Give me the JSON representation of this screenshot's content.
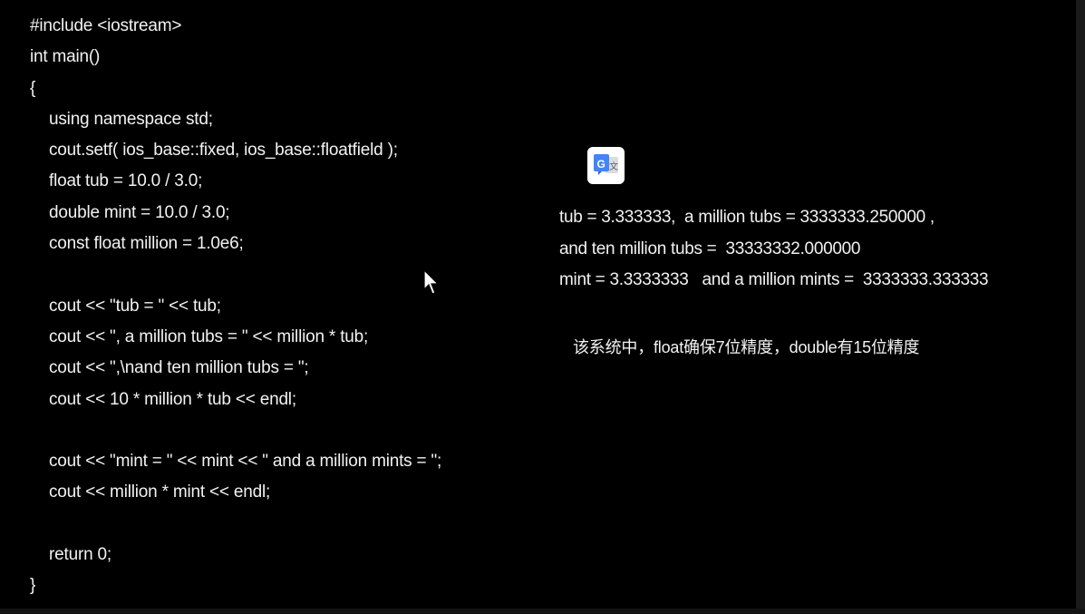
{
  "code": {
    "lines": [
      "#include <iostream>",
      "int main()",
      "{",
      "using namespace std;",
      "cout.setf( ios_base::fixed, ios_base::floatfield );",
      "float tub = 10.0 / 3.0;",
      "double mint = 10.0 / 3.0;",
      "const float million = 1.0e6;",
      "",
      "cout << \"tub = \" << tub;",
      "cout << \", a million tubs = \" << million * tub;",
      "cout << \",\\nand ten million tubs = \";",
      "cout << 10 * million * tub << endl;",
      "",
      "cout << \"mint = \" << mint << \" and a million mints = \";",
      "cout << million * mint << endl;",
      "",
      "return 0;",
      "}"
    ]
  },
  "output": {
    "lines": [
      "tub = 3.333333,  a million tubs = 3333333.250000 ,",
      "and ten million tubs =  33333332.000000",
      "mint = 3.3333333   and a million mints =  3333333.333333"
    ]
  },
  "note": "该系统中，float确保7位精度，double有15位精度",
  "translate_button": {
    "icon": "google-translate-icon",
    "accent_blue": "#4285f4",
    "accent_gray": "#dadce0"
  },
  "colors": {
    "background": "#000000",
    "text": "#f2f2f2"
  }
}
